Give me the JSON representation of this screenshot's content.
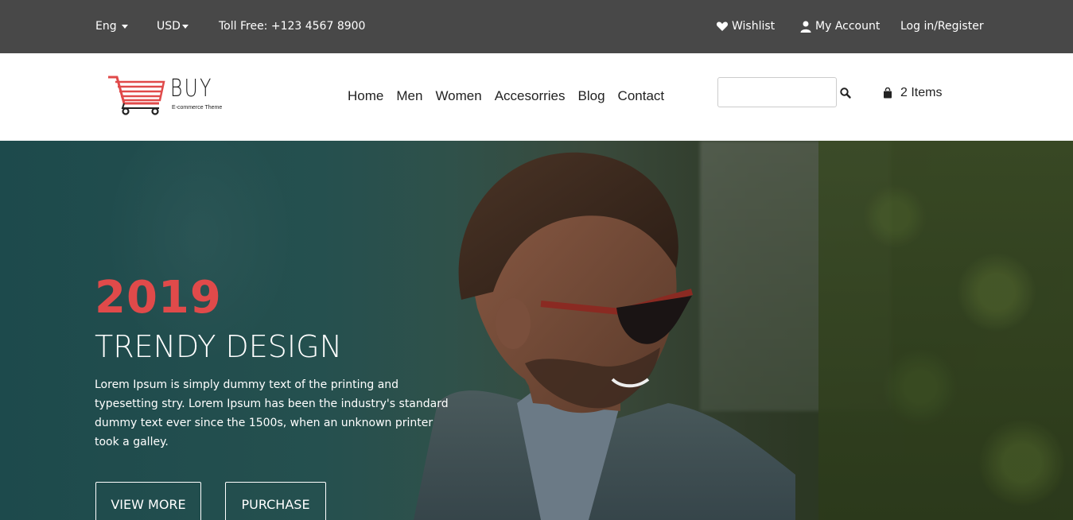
{
  "topbar": {
    "language": "Eng",
    "currency": "USD",
    "tollfree": "Toll Free: +123 4567 8900",
    "wishlist": "Wishlist",
    "account": "My Account",
    "login": "Log in/Register",
    "icons": {
      "wishlist": "heart-icon",
      "account": "user-icon"
    }
  },
  "header": {
    "logo": {
      "word": "BUY",
      "sub": "E-commerce Theme"
    },
    "nav": [
      "Home",
      "Men",
      "Women",
      "Accesorries",
      "Blog",
      "Contact"
    ],
    "search": {
      "value": "",
      "placeholder": ""
    },
    "cart": {
      "label": "2 Items",
      "icon": "shopping-bag-icon"
    }
  },
  "hero": {
    "year": "2019",
    "title": "TRENDY DESIGN",
    "text": "Lorem Ipsum is simply dummy text of the printing and typesetting stry. Lorem Ipsum has been the industry's standard dummy text ever since the 1500s, when an unknown printer took a galley.",
    "buttons": {
      "view_more": "VIEW MORE",
      "purchase": "PURCHASE"
    }
  },
  "colors": {
    "topbar": "#484848",
    "accent": "#e04a4a",
    "text": "#222222"
  }
}
